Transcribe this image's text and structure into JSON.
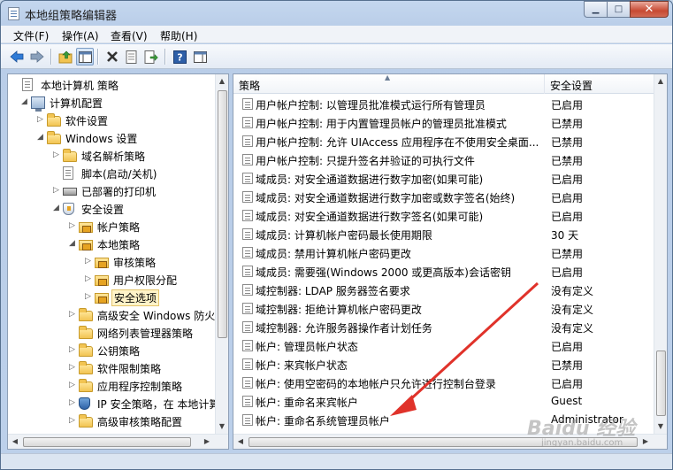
{
  "window": {
    "title": "本地组策略编辑器",
    "minimize": "▁",
    "maximize": "□",
    "close": "✕"
  },
  "menu": [
    "文件(F)",
    "操作(A)",
    "查看(V)",
    "帮助(H)"
  ],
  "toolbar": {
    "icons": [
      "back-arrow-icon",
      "forward-arrow-icon",
      "up-folder-icon",
      "show-hide-tree-icon",
      "delete-icon",
      "properties-icon",
      "export-list-icon",
      "help-icon",
      "show-hide-action-pane-icon"
    ]
  },
  "tree": [
    {
      "label": "本地计算机 策略",
      "level": 0,
      "expanded": true,
      "icon": "computer-policy-icon"
    },
    {
      "label": "计算机配置",
      "level": 1,
      "expanded": true,
      "icon": "computer-icon"
    },
    {
      "label": "软件设置",
      "level": 2,
      "expanded": false,
      "icon": "folder-icon"
    },
    {
      "label": "Windows 设置",
      "level": 2,
      "expanded": true,
      "icon": "folder-icon"
    },
    {
      "label": "域名解析策略",
      "level": 3,
      "expanded": false,
      "icon": "folder-icon"
    },
    {
      "label": "脚本(启动/关机)",
      "level": 3,
      "leaf": true,
      "icon": "script-icon"
    },
    {
      "label": "已部署的打印机",
      "level": 3,
      "expanded": false,
      "icon": "printer-icon"
    },
    {
      "label": "安全设置",
      "level": 3,
      "expanded": true,
      "icon": "security-icon"
    },
    {
      "label": "帐户策略",
      "level": 4,
      "expanded": false,
      "icon": "lock-folder-icon"
    },
    {
      "label": "本地策略",
      "level": 4,
      "expanded": true,
      "icon": "lock-folder-icon"
    },
    {
      "label": "审核策略",
      "level": 5,
      "expanded": false,
      "icon": "lock-folder-icon"
    },
    {
      "label": "用户权限分配",
      "level": 5,
      "expanded": false,
      "icon": "lock-folder-icon"
    },
    {
      "label": "安全选项",
      "level": 5,
      "expanded": false,
      "icon": "lock-folder-icon",
      "selected": true
    },
    {
      "label": "高级安全 Windows 防火",
      "level": 4,
      "expanded": false,
      "icon": "folder-icon"
    },
    {
      "label": "网络列表管理器策略",
      "level": 4,
      "leaf": true,
      "icon": "folder-icon"
    },
    {
      "label": "公钥策略",
      "level": 4,
      "expanded": false,
      "icon": "folder-icon"
    },
    {
      "label": "软件限制策略",
      "level": 4,
      "expanded": false,
      "icon": "folder-icon"
    },
    {
      "label": "应用程序控制策略",
      "level": 4,
      "expanded": false,
      "icon": "folder-icon"
    },
    {
      "label": "IP 安全策略，在 本地计算",
      "level": 4,
      "expanded": false,
      "icon": "ip-security-icon"
    },
    {
      "label": "高级审核策略配置",
      "level": 4,
      "expanded": false,
      "icon": "folder-icon"
    }
  ],
  "list": {
    "columns": {
      "policy": "策略",
      "setting": "安全设置"
    },
    "rows": [
      {
        "policy": "用户帐户控制: 以管理员批准模式运行所有管理员",
        "setting": "已启用"
      },
      {
        "policy": "用户帐户控制: 用于内置管理员帐户的管理员批准模式",
        "setting": "已禁用"
      },
      {
        "policy": "用户帐户控制: 允许 UIAccess 应用程序在不使用安全桌面...",
        "setting": "已禁用"
      },
      {
        "policy": "用户帐户控制: 只提升签名并验证的可执行文件",
        "setting": "已禁用"
      },
      {
        "policy": "域成员: 对安全通道数据进行数字加密(如果可能)",
        "setting": "已启用"
      },
      {
        "policy": "域成员: 对安全通道数据进行数字加密或数字签名(始终)",
        "setting": "已启用"
      },
      {
        "policy": "域成员: 对安全通道数据进行数字签名(如果可能)",
        "setting": "已启用"
      },
      {
        "policy": "域成员: 计算机帐户密码最长使用期限",
        "setting": "30 天"
      },
      {
        "policy": "域成员: 禁用计算机帐户密码更改",
        "setting": "已禁用"
      },
      {
        "policy": "域成员: 需要强(Windows 2000 或更高版本)会话密钥",
        "setting": "已启用"
      },
      {
        "policy": "域控制器: LDAP 服务器签名要求",
        "setting": "没有定义"
      },
      {
        "policy": "域控制器: 拒绝计算机帐户密码更改",
        "setting": "没有定义"
      },
      {
        "policy": "域控制器: 允许服务器操作者计划任务",
        "setting": "没有定义"
      },
      {
        "policy": "帐户: 管理员帐户状态",
        "setting": "已启用"
      },
      {
        "policy": "帐户: 来宾帐户状态",
        "setting": "已禁用"
      },
      {
        "policy": "帐户: 使用空密码的本地帐户只允许进行控制台登录",
        "setting": "已启用"
      },
      {
        "policy": "帐户: 重命名来宾帐户",
        "setting": "Guest"
      },
      {
        "policy": "帐户: 重命名系统管理员帐户",
        "setting": "Administrator"
      }
    ]
  },
  "watermark": {
    "text": "Baidu 经验",
    "sub": "jingyan.baidu.com"
  },
  "annotation_color": "#e0322a"
}
